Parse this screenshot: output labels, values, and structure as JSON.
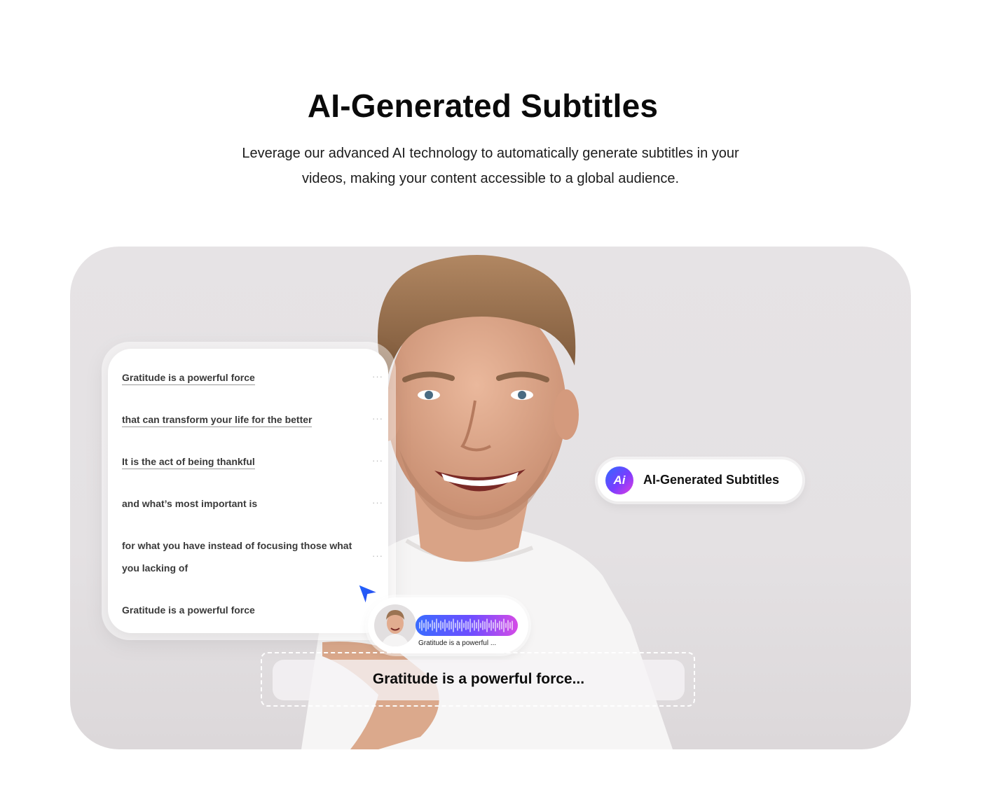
{
  "header": {
    "title": "AI-Generated Subtitles",
    "description": "Leverage our advanced AI technology to automatically generate subtitles in your videos, making your content accessible to a global audience."
  },
  "transcript": {
    "lines": [
      "Gratitude is a powerful force",
      "that can transform your life for the better",
      "It is the act of being thankful",
      "and what’s most important is",
      "for what you have instead of focusing those what",
      "you lacking of",
      "Gratitude is a powerful force"
    ],
    "more_glyph": "···"
  },
  "ai_badge": {
    "icon_text": "Ai",
    "label": "AI-Generated Subtitles"
  },
  "audio_chip": {
    "caption": "Gratitude is a powerful ..."
  },
  "subtitle": {
    "text": "Gratitude is a powerful force..."
  },
  "colors": {
    "accent_start": "#2f6bff",
    "accent_mid": "#7a3dff",
    "accent_end": "#e23de0"
  }
}
